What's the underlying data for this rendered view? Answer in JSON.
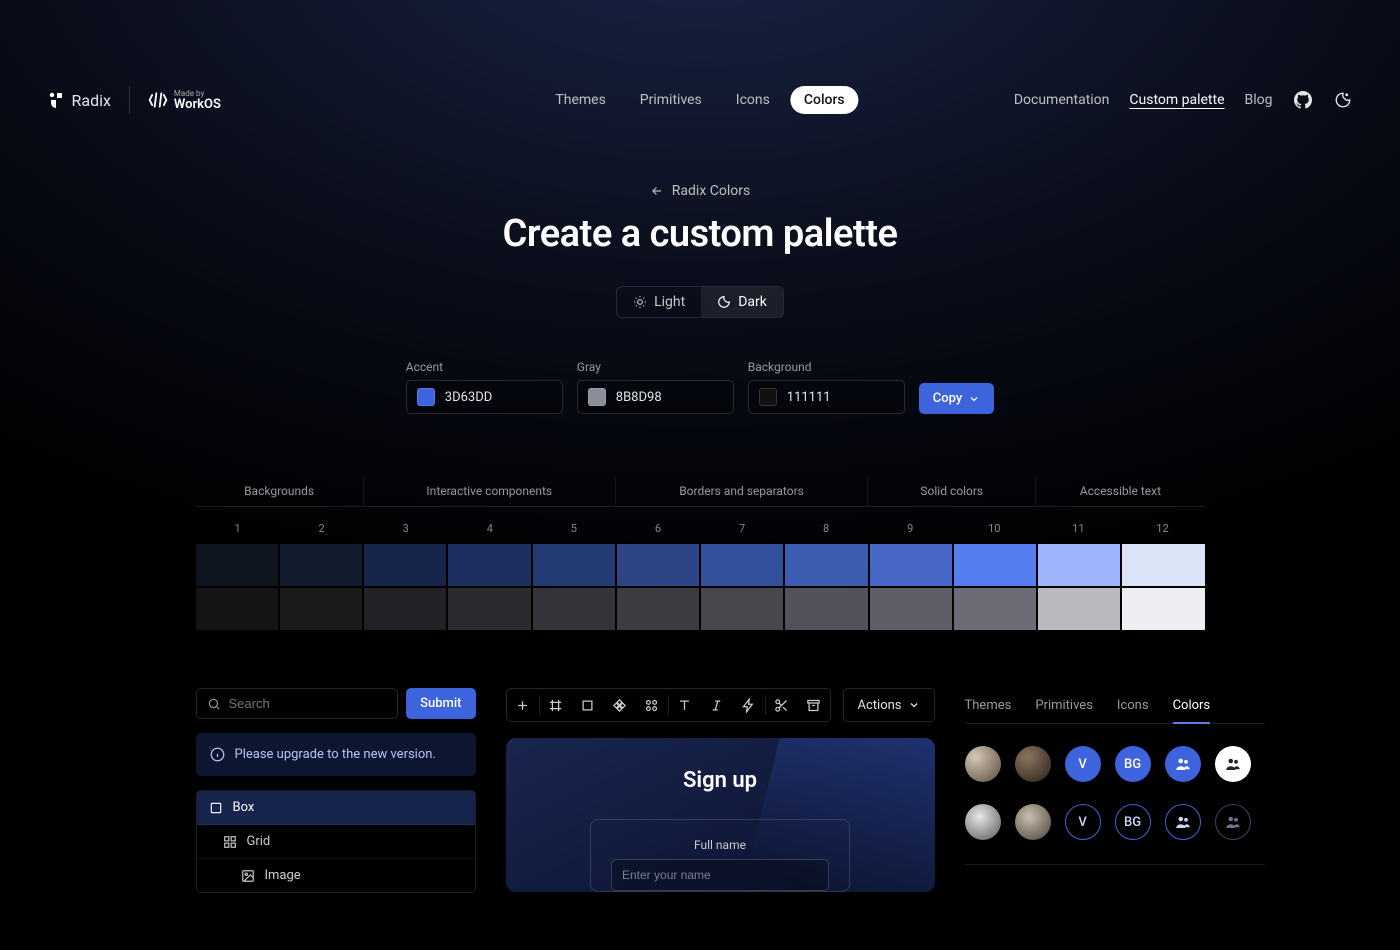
{
  "brand": {
    "radix": "Radix",
    "made_by": "Made by",
    "workos": "WorkOS"
  },
  "nav": {
    "themes": "Themes",
    "primitives": "Primitives",
    "icons": "Icons",
    "colors": "Colors"
  },
  "header_right": {
    "docs": "Documentation",
    "custom": "Custom palette",
    "blog": "Blog"
  },
  "back": {
    "label": "Radix Colors"
  },
  "title": "Create a custom palette",
  "mode": {
    "light": "Light",
    "dark": "Dark"
  },
  "inputs": {
    "accent": {
      "label": "Accent",
      "value": "3D63DD",
      "hex": "#3D63DD"
    },
    "gray": {
      "label": "Gray",
      "value": "8B8D98",
      "hex": "#8B8D98"
    },
    "bg": {
      "label": "Background",
      "value": "111111",
      "hex": "#111111"
    },
    "copy": "Copy"
  },
  "scale_headers": [
    "Backgrounds",
    "Interactive components",
    "Borders and separators",
    "Solid colors",
    "Accessible text"
  ],
  "scale_nums": [
    "1",
    "2",
    "3",
    "4",
    "5",
    "6",
    "7",
    "8",
    "9",
    "10",
    "11",
    "12"
  ],
  "accent_scale": [
    "#0e1420",
    "#121a2e",
    "#18254a",
    "#1d2f5e",
    "#243a72",
    "#2b4586",
    "#33509a",
    "#3c5cb0",
    "#4768c7",
    "#567df0",
    "#9db5ff",
    "#dbe3f7"
  ],
  "gray_scale": [
    "#141416",
    "#1a1a1d",
    "#222226",
    "#2a2a2f",
    "#333339",
    "#3c3c42",
    "#47474e",
    "#52525a",
    "#5e5e67",
    "#6c6c76",
    "#b9b9c0",
    "#eceef2"
  ],
  "preview": {
    "search_placeholder": "Search",
    "submit": "Submit",
    "notice": "Please upgrade to the new version.",
    "tree": {
      "box": "Box",
      "grid": "Grid",
      "image": "Image"
    },
    "actions": "Actions",
    "signup_title": "Sign up",
    "fullname_label": "Full name",
    "fullname_placeholder": "Enter your name",
    "tabs": {
      "themes": "Themes",
      "primitives": "Primitives",
      "icons": "Icons",
      "colors": "Colors"
    },
    "av_v": "V",
    "av_bg": "BG"
  }
}
